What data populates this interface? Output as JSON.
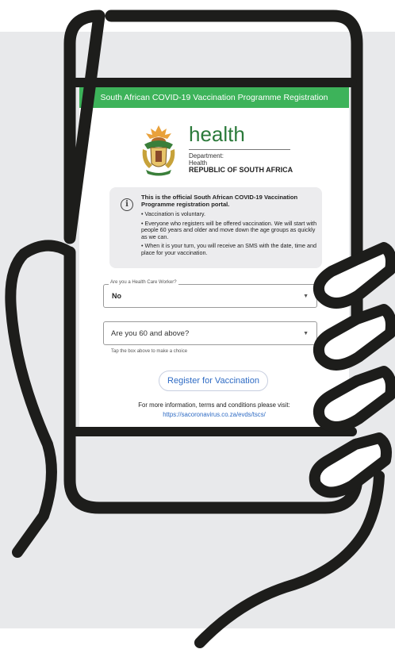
{
  "header": {
    "title": "South African COVID-19 Vaccination Programme Registration"
  },
  "branding": {
    "wordmark": "health",
    "line1": "Department:",
    "line2": "Health",
    "line3": "REPUBLIC OF SOUTH AFRICA"
  },
  "info": {
    "heading": "This is the official South African COVID-19 Vaccination Programme registration portal.",
    "bullets": [
      "• Vaccination is voluntary.",
      "• Everyone who registers will be offered vaccination. We will start with people 60 years and older and move down the age groups as quickly as we can.",
      "• When it is your turn, you will receive an SMS with the date, time and place for your vaccination."
    ]
  },
  "form": {
    "health_worker": {
      "label": "Are you a Health Care Worker?",
      "value": "No"
    },
    "age": {
      "placeholder": "Are you 60 and above?",
      "helper": "Tap the box above to make a choice"
    },
    "register_label": "Register for Vaccination"
  },
  "footer": {
    "text": "For more information, terms and conditions please visit:",
    "link": "https://sacoronavirus.co.za/evds/tscs/"
  },
  "colors": {
    "header_green": "#3db35a",
    "brand_green": "#2b7a3a",
    "link_blue": "#2e6bc4",
    "frame": "#1d1d1b"
  }
}
